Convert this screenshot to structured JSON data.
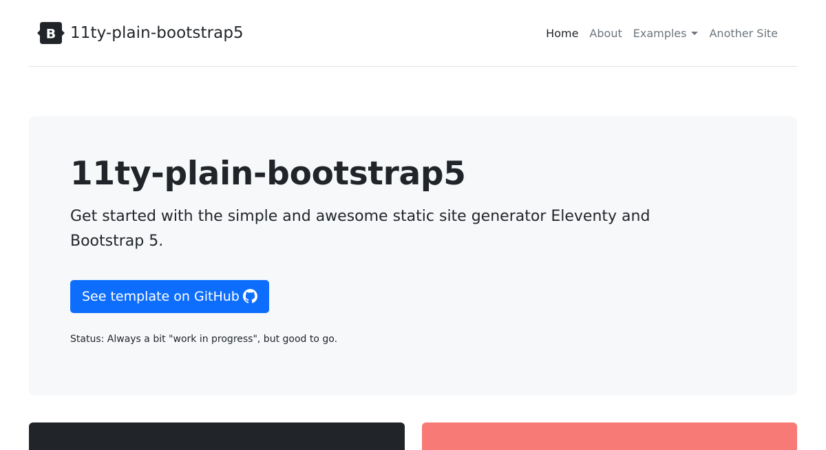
{
  "header": {
    "brand_name": "11ty-plain-bootstrap5",
    "nav": [
      {
        "label": "Home",
        "active": true
      },
      {
        "label": "About",
        "active": false
      },
      {
        "label": "Examples",
        "active": false,
        "dropdown": true
      },
      {
        "label": "Another Site",
        "active": false
      }
    ]
  },
  "hero": {
    "title": "11ty-plain-bootstrap5",
    "lead": "Get started with the simple and awesome static site generator Eleventy and Bootstrap 5.",
    "button_label": "See template on GitHub",
    "status": "Status: Always a bit \"work in progress\", but good to go."
  },
  "colors": {
    "primary": "#0d6efd",
    "hero_bg": "#f7f8fa",
    "card_dark": "#212529",
    "card_red": "#f87a77"
  },
  "icons": {
    "brand": "bootstrap-logo-icon",
    "button": "github-icon",
    "dropdown": "caret-down-icon"
  }
}
